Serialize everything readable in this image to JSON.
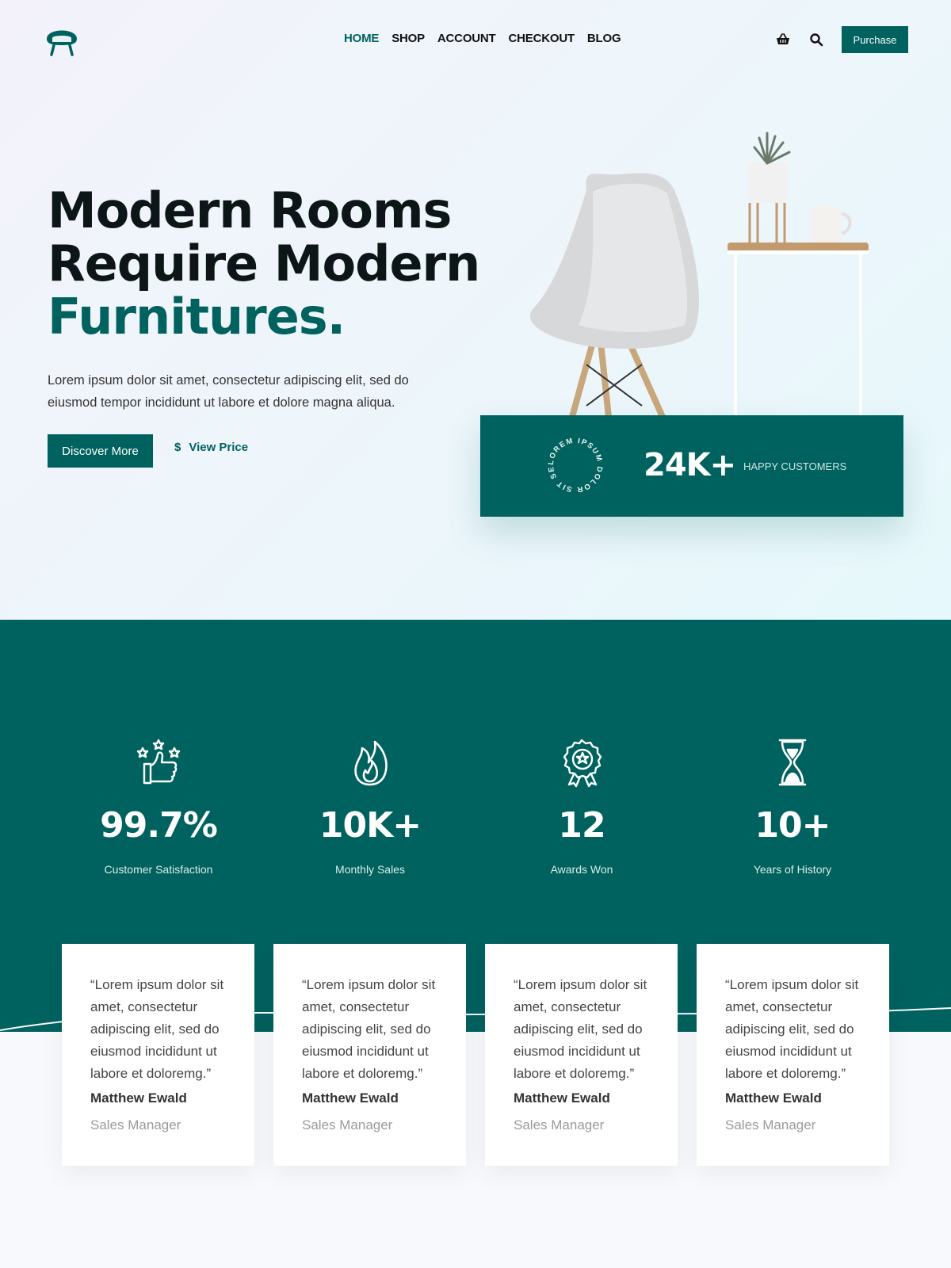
{
  "nav": {
    "items": [
      {
        "label": "HOME",
        "active": true
      },
      {
        "label": "SHOP",
        "active": false
      },
      {
        "label": "ACCOUNT",
        "active": false
      },
      {
        "label": "CHECKOUT",
        "active": false
      },
      {
        "label": "BLOG",
        "active": false
      }
    ],
    "purchase_label": "Purchase",
    "icons": [
      "basket-icon",
      "search-icon"
    ]
  },
  "hero": {
    "title_line1": "Modern Rooms",
    "title_line2": "Require Modern",
    "title_accent": "Furnitures.",
    "description": "Lorem ipsum dolor sit amet, consectetur adipiscing elit, sed do eiusmod tempor incididunt ut labore et dolore magna aliqua.",
    "discover_label": "Discover More",
    "view_price_label": "View Price"
  },
  "stat_card": {
    "ring_text": "LOREM IPSUM DOLOR SIT SED D",
    "value": "24K+",
    "label": "HAPPY CUSTOMERS"
  },
  "stats": [
    {
      "icon": "thumbs-up-stars-icon",
      "value": "99.7%",
      "caption": "Customer Satisfaction"
    },
    {
      "icon": "flame-icon",
      "value": "10K+",
      "caption": "Monthly Sales"
    },
    {
      "icon": "award-badge-icon",
      "value": "12",
      "caption": "Awards Won"
    },
    {
      "icon": "hourglass-icon",
      "value": "10+",
      "caption": "Years of History"
    }
  ],
  "testimonials": [
    {
      "quote": "“Lorem ipsum dolor sit amet, consectetur adipiscing elit, sed do eiusmod incididunt ut labore et doloremg.”",
      "name": "Matthew Ewald",
      "role": "Sales Manager"
    },
    {
      "quote": "“Lorem ipsum dolor sit amet, consectetur adipiscing elit, sed do eiusmod incididunt ut labore et doloremg.”",
      "name": "Matthew Ewald",
      "role": "Sales Manager"
    },
    {
      "quote": "“Lorem ipsum dolor sit amet, consectetur adipiscing elit, sed do eiusmod incididunt ut labore et doloremg.”",
      "name": "Matthew Ewald",
      "role": "Sales Manager"
    },
    {
      "quote": "“Lorem ipsum dolor sit amet, consectetur adipiscing elit, sed do eiusmod incididunt ut labore et doloremg.”",
      "name": "Matthew Ewald",
      "role": "Sales Manager"
    }
  ],
  "colors": {
    "brand": "#00625f",
    "background": "#f7f9fc",
    "text": "#0d1616"
  }
}
